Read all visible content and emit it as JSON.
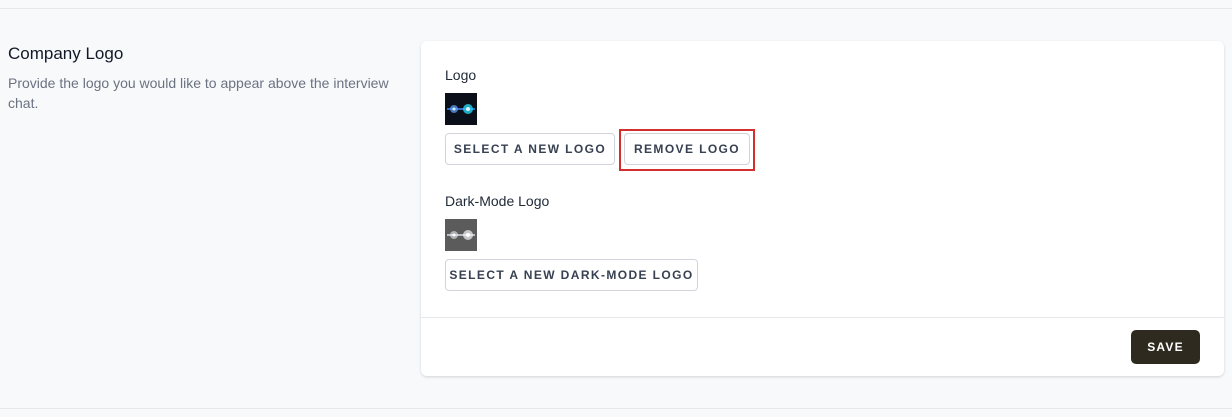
{
  "section": {
    "title": "Company Logo",
    "description": "Provide the logo you would like to appear above the interview chat."
  },
  "logo": {
    "label": "Logo",
    "thumbnail_icon": "logo-thumbnail-icon",
    "select_button": "SELECT A NEW LOGO",
    "remove_button": "REMOVE LOGO"
  },
  "dark_logo": {
    "label": "Dark-Mode Logo",
    "thumbnail_icon": "dark-mode-logo-thumbnail-icon",
    "select_button": "SELECT A NEW DARK-MODE LOGO"
  },
  "footer": {
    "save_button": "SAVE"
  },
  "colors": {
    "save_bg": "#2e2a1f",
    "highlight": "#d32f2f",
    "page_bg": "#f8f9fb"
  }
}
